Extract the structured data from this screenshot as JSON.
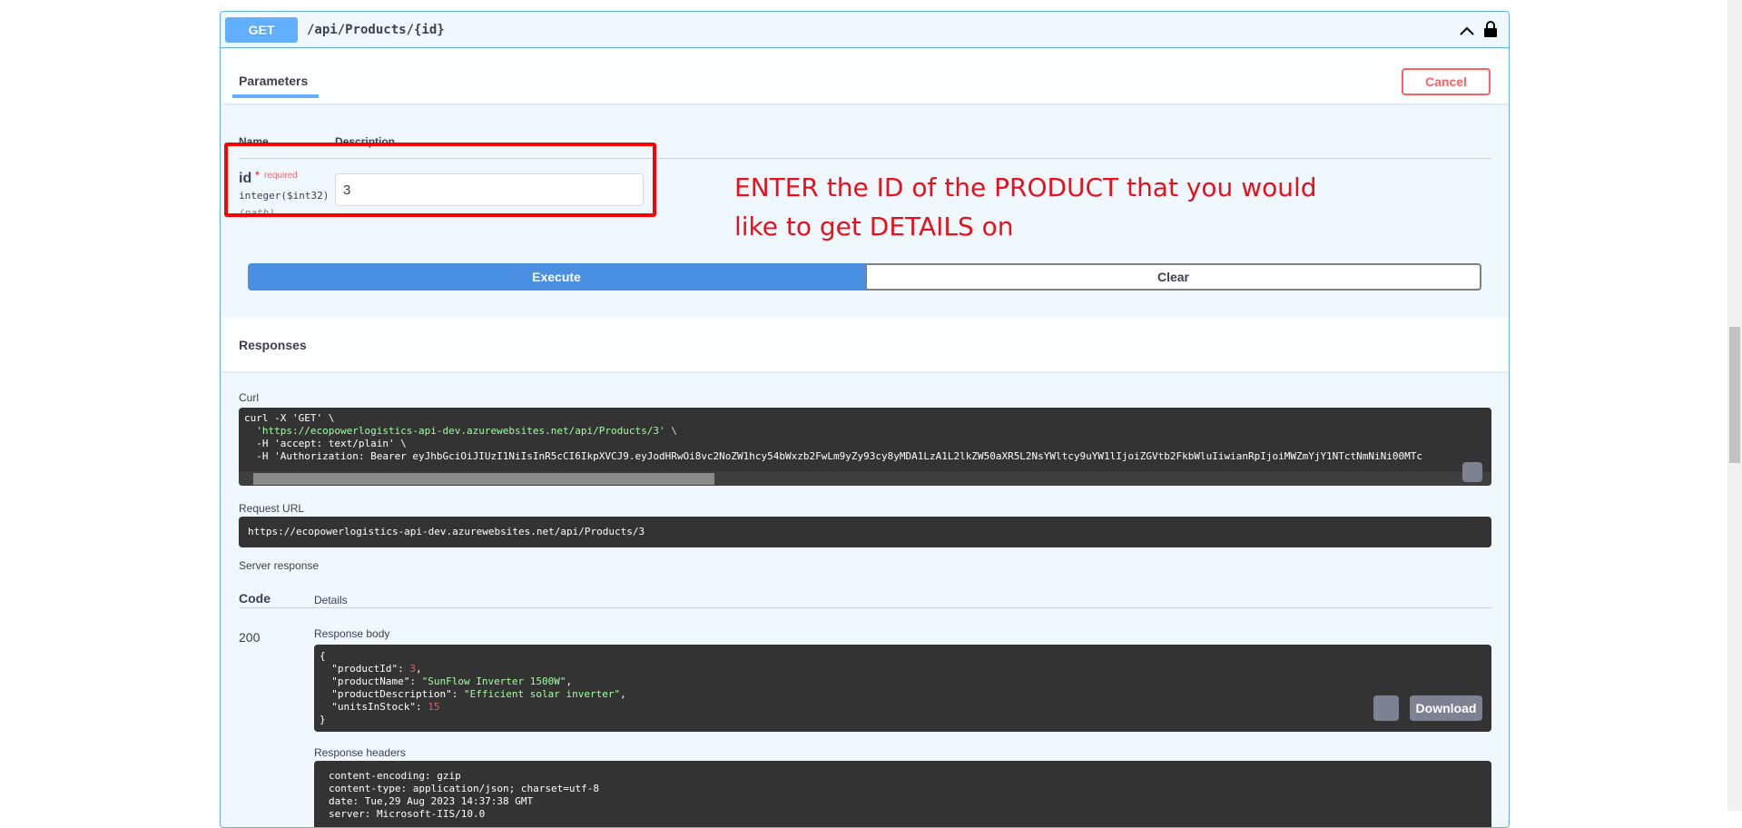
{
  "operation": {
    "method": "GET",
    "path": "/api/Products/{id}"
  },
  "parameters": {
    "tab_label": "Parameters",
    "cancel_label": "Cancel",
    "col_name": "Name",
    "col_description": "Description",
    "param": {
      "name": "id",
      "required_star": "*",
      "required_label": "required",
      "type": "integer($int32)",
      "location": "(path)",
      "value": "3"
    }
  },
  "annotation": {
    "line1": "ENTER the ID of the PRODUCT that you would",
    "line2": "like to get DETAILS on"
  },
  "actions": {
    "execute_label": "Execute",
    "clear_label": "Clear"
  },
  "responses": {
    "title": "Responses",
    "curl_label": "Curl",
    "curl_lines": [
      "curl -X 'GET' \\",
      "  'https://ecopowerlogistics-api-dev.azurewebsites.net/api/Products/3' \\",
      "  -H 'accept: text/plain' \\",
      "  -H 'Authorization: Bearer eyJhbGciOiJIUzI1NiIsInR5cCI6IkpXVCJ9.eyJodHRwOi8vc2NoZW1hcy54bWxzb2FwLm9yZy93cy8yMDA1LzA1L2lkZW50aXR5L2NsYWltcy9uYW1lIjoiZGVtb2FkbWluIiwianRpIjoiMWZmYjY1NTctNmNiNi00MTc"
    ],
    "request_url_label": "Request URL",
    "request_url": "https://ecopowerlogistics-api-dev.azurewebsites.net/api/Products/3",
    "server_response_label": "Server response",
    "code_header": "Code",
    "details_header": "Details",
    "status_code": "200",
    "response_body_label": "Response body",
    "response_body": {
      "open": "{",
      "productId_key": "\"productId\"",
      "productId_val": "3",
      "productName_key": "\"productName\"",
      "productName_val": "\"SunFlow Inverter 1500W\"",
      "productDescription_key": "\"productDescription\"",
      "productDescription_val": "\"Efficient solar inverter\"",
      "unitsInStock_key": "\"unitsInStock\"",
      "unitsInStock_val": "15",
      "close": "}"
    },
    "download_label": "Download",
    "response_headers_label": "Response headers",
    "headers": [
      "content-encoding: gzip",
      "content-type: application/json; charset=utf-8",
      "date: Tue,29 Aug 2023 14:37:38 GMT",
      "server: Microsoft-IIS/10.0"
    ]
  }
}
